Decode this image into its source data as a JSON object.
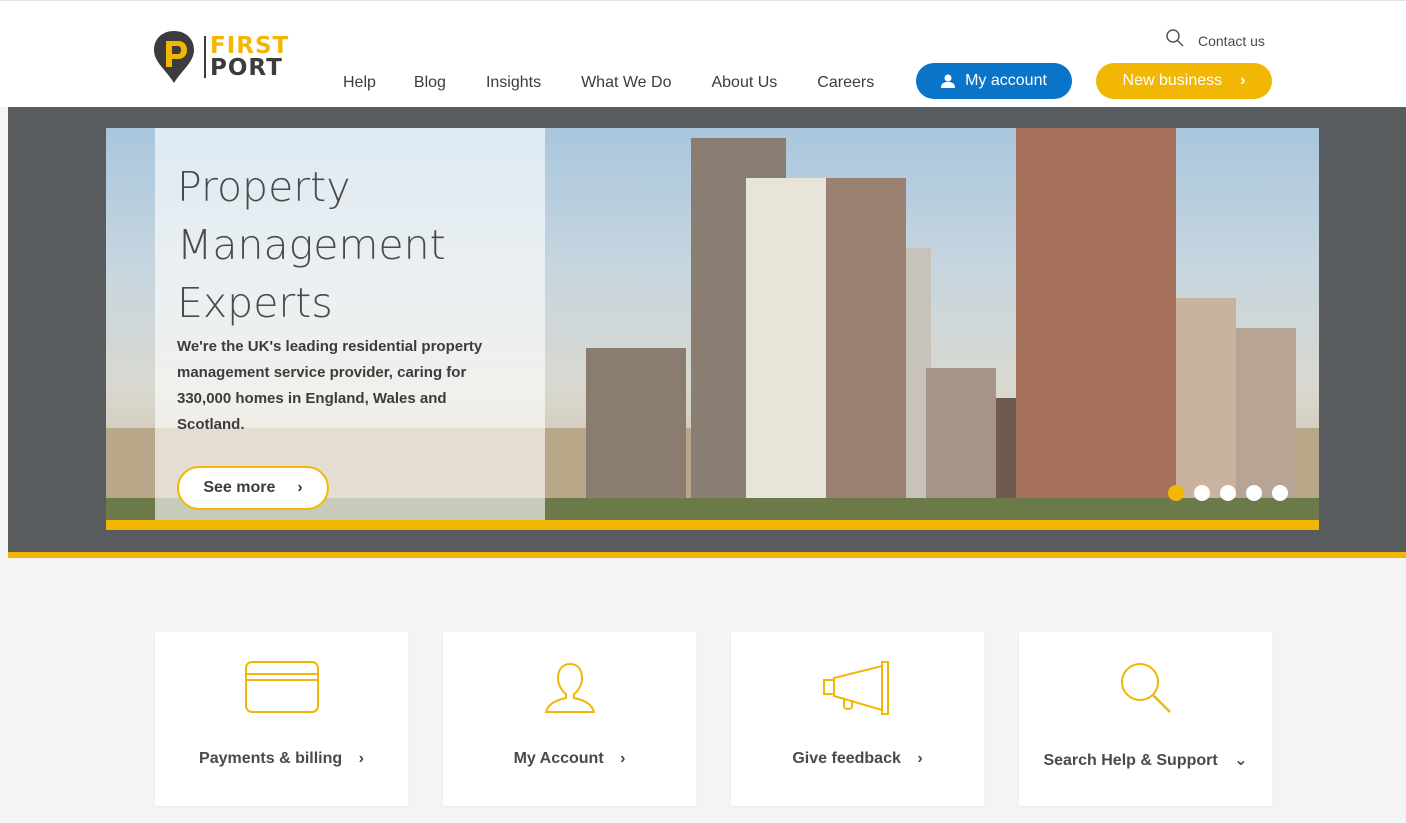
{
  "brand": {
    "name_line1": "FIRST",
    "name_line2": "PORT",
    "primary_color": "#f2b705",
    "accent_color": "#0a74c9"
  },
  "header": {
    "nav": [
      "Help",
      "Blog",
      "Insights",
      "What We Do",
      "About Us",
      "Careers"
    ],
    "search_icon": "search-icon",
    "contact_label": "Contact us",
    "account_button": "My account",
    "new_business_button": "New business",
    "chevron": "›"
  },
  "hero": {
    "title": "Property Management Experts",
    "text": "We're the UK's leading residential property management service provider, caring for 330,000 homes in England, Wales and Scotland.",
    "button": "See more",
    "chevron": "›",
    "slides": 5,
    "active_slide": 1
  },
  "cards": [
    {
      "label": "Payments & billing",
      "icon": "credit-card-icon",
      "chevron": "›"
    },
    {
      "label": "My Account",
      "icon": "user-icon",
      "chevron": "›"
    },
    {
      "label": "Give feedback",
      "icon": "megaphone-icon",
      "chevron": "›"
    },
    {
      "label": "Search Help & Support",
      "icon": "search-icon",
      "chevron": "⌄"
    }
  ]
}
